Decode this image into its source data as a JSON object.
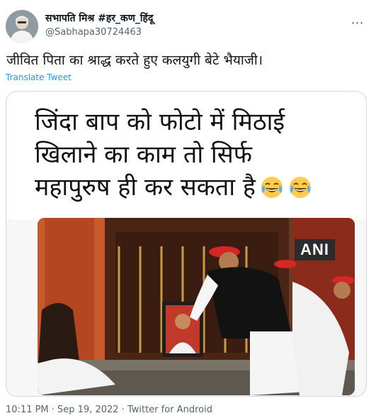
{
  "user": {
    "display_name": "सभापति मिश्र #हर_कण_हिंदू",
    "handle": "@Sabhapa30724463"
  },
  "tweet": {
    "text": "जीवित पिता का श्राद्ध करते हुए कलयुगी बेटे भैयाजी।",
    "translate_label": "Translate Tweet"
  },
  "media": {
    "meme_lines": [
      "जिंदा बाप को फोटो में मिठाई",
      "खिलाने का काम तो सिर्फ",
      "महापुरुष ही कर सकता है"
    ],
    "watermark": "ANI"
  },
  "meta": {
    "timestamp": "10:11 PM · Sep 19, 2022 · Twitter for Android"
  },
  "icons": {
    "more": "more-icon",
    "emoji": "laughing-tears-emoji"
  }
}
